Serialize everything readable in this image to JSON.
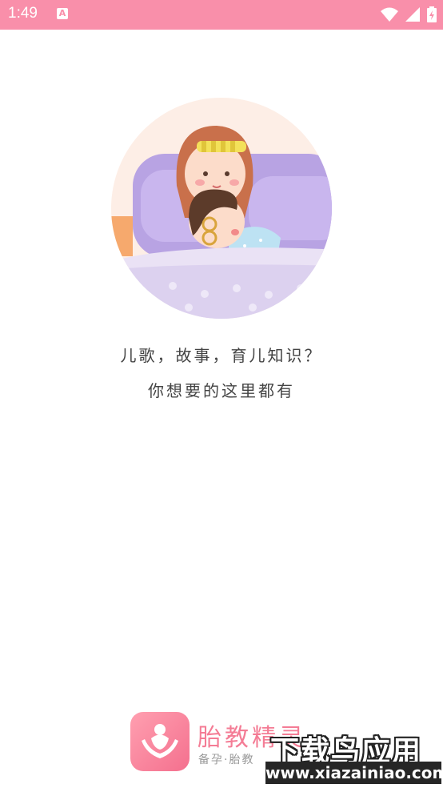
{
  "status_bar": {
    "time": "1:49",
    "notification_badge": "A",
    "icons": [
      "wifi-icon",
      "signal-icon",
      "battery-icon"
    ],
    "background": "#f98faa"
  },
  "illustration": {
    "description_icon": "mother-child-sleeping-illustration"
  },
  "slogan": {
    "line1": "儿歌，故事，育儿知识？",
    "line2": "你想要的这里都有"
  },
  "brand": {
    "title": "胎教精灵",
    "subtitle": "备孕·胎教",
    "accent": "#f47c95"
  },
  "watermark": {
    "main": "下载鸟应用",
    "url": "www.xiazainiao.com"
  }
}
